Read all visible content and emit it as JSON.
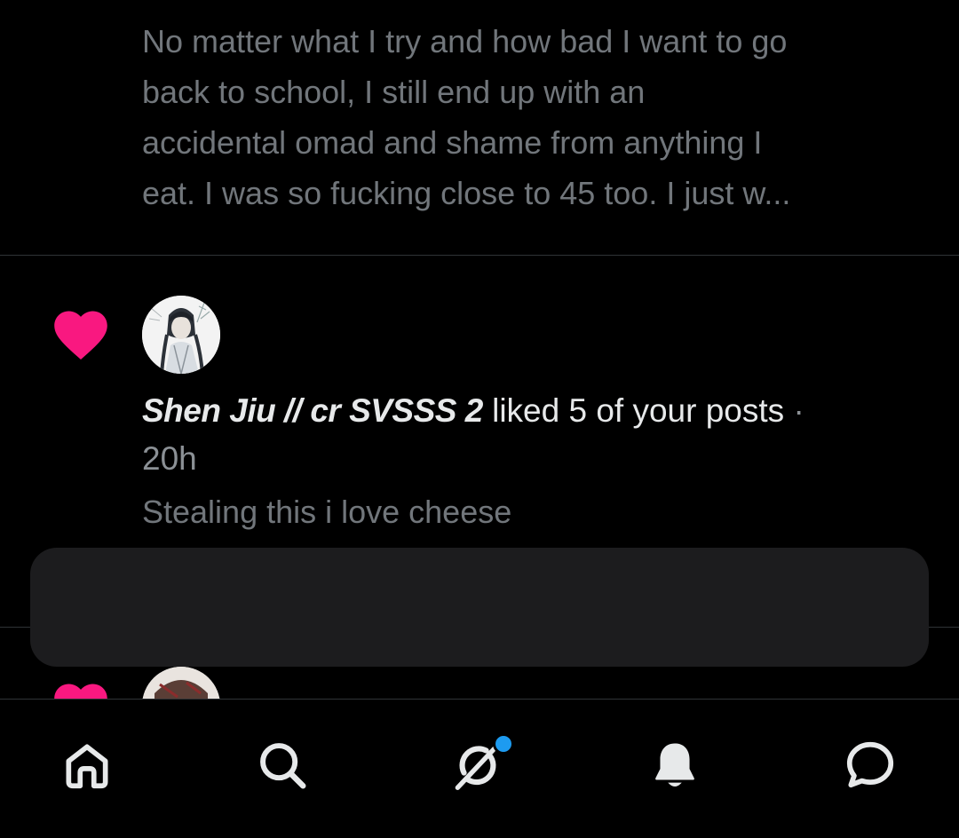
{
  "previous_notification": {
    "snippet": "No matter what I try and how bad I want to go\nback to school, I still end up with an\naccidental omad and shame from anything I\neat. I was so fucking close to 45 too. I just w..."
  },
  "like_notification": {
    "icon": "heart-icon",
    "icon_color": "#f91880",
    "user_name": "Shen Jiu // cr SVSSS 2",
    "action": " liked 5 of your posts",
    "separator": " ·",
    "time": "20h",
    "post_text": "Stealing this i love cheese"
  },
  "next_notification": {
    "icon": "heart-icon",
    "icon_color": "#f91880"
  },
  "bottom_nav": {
    "items": [
      {
        "icon": "home-icon"
      },
      {
        "icon": "search-icon"
      },
      {
        "icon": "grok-icon",
        "badge": true
      },
      {
        "icon": "bell-icon",
        "active": true
      },
      {
        "icon": "messages-icon"
      }
    ],
    "badge_color": "#1d9bf0"
  }
}
